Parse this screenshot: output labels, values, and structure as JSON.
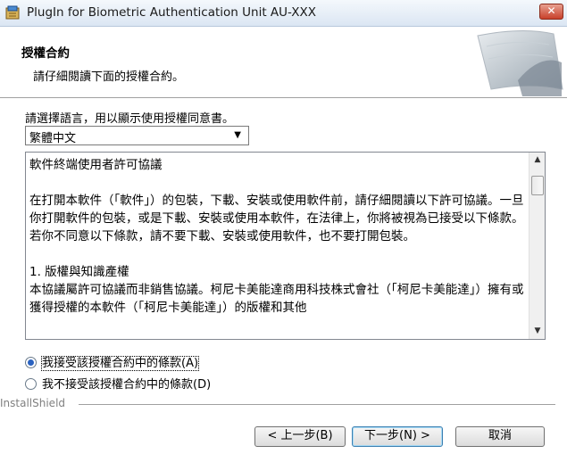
{
  "window": {
    "title": "PlugIn for Biometric Authentication Unit AU-XXX",
    "close_glyph": "✕"
  },
  "header": {
    "title": "授權合約",
    "subtitle": "請仔細閱讀下面的授權合約。"
  },
  "language": {
    "label": "請選擇語言，用以顯示使用授權同意書。",
    "selected": "繁體中文"
  },
  "license": {
    "paragraphs": [
      "軟件終端使用者許可協議",
      "在打開本軟件（「軟件」）的包裝，下載、安裝或使用軟件前，請仔細閱讀以下許可協議。一旦你打開軟件的包裝，或是下載、安裝或使用本軟件，在法律上，你將被視為已接受以下條款。若你不同意以下條款，請不要下載、安裝或使用軟件，也不要打開包裝。",
      "1. 版權與知識產權",
      "本協議屬許可協議而非銷售協議。柯尼卡美能達商用科技株式會社（「柯尼卡美能達」）擁有或獲得授權的本軟件（「柯尼卡美能達」）的版權和其他"
    ]
  },
  "options": {
    "accept": "我接受該授權合約中的條款(A)",
    "decline": "我不接受該授權合約中的條款(D)",
    "selected": "accept"
  },
  "footer": {
    "brand": "InstallShield",
    "back": "< 上一步(B)",
    "next": "下一步(N) >",
    "cancel": "取消"
  }
}
